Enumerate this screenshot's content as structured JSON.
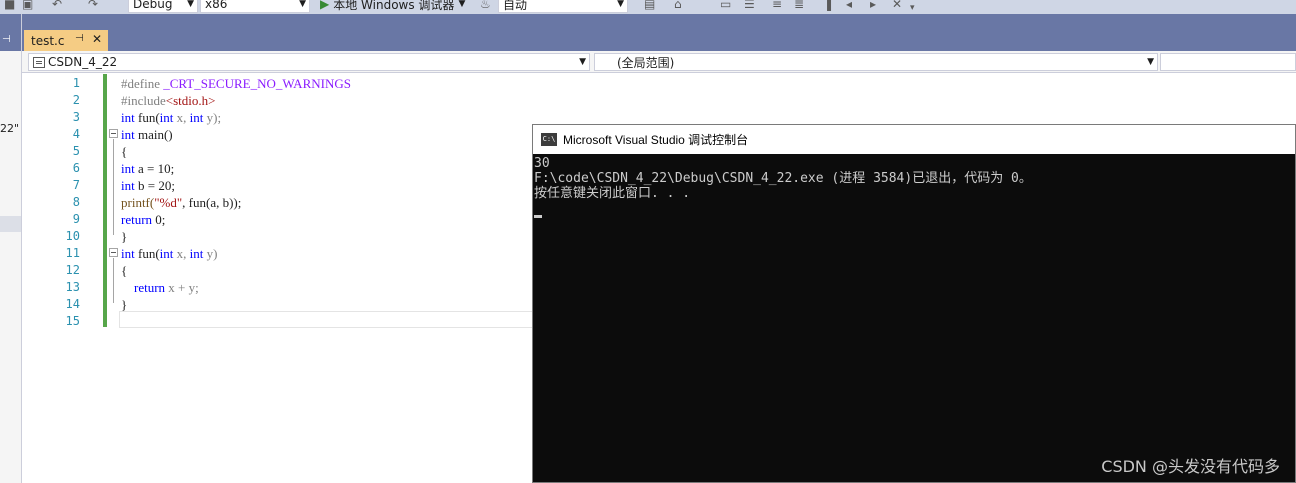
{
  "toolbar": {
    "config": "Debug",
    "platform": "x86",
    "run_label": "本地 Windows 调试器",
    "run_mode": "自动"
  },
  "left_panel": {
    "truncated_text": "22\""
  },
  "tabs": [
    {
      "label": "test.c",
      "active": true
    }
  ],
  "nav": {
    "project": "CSDN_4_22",
    "scope": "(全局范围)"
  },
  "editor": {
    "line_numbers": [
      "1",
      "2",
      "3",
      "4",
      "5",
      "6",
      "7",
      "8",
      "9",
      "10",
      "11",
      "12",
      "13",
      "14",
      "15"
    ],
    "lines": {
      "l1": {
        "pp": "#define ",
        "mac": "_CRT_SECURE_NO_WARNINGS"
      },
      "l2": {
        "pp": "#include",
        "str": "<stdio.h>"
      },
      "l3": {
        "kw1": "int",
        "fn": " fun(",
        "kw2": "int",
        "p1": " x, ",
        "kw3": "int",
        "p2": " y);"
      },
      "l4": {
        "kw": "int",
        "rest": " main()"
      },
      "l5": {
        "text": "{"
      },
      "l6": {
        "kw": "int",
        "rest": " a = 10;"
      },
      "l7": {
        "kw": "int",
        "rest": " b = 20;"
      },
      "l8": {
        "fn": "printf(",
        "str": "\"%d\"",
        "rest": ", fun(a, b));"
      },
      "l9": {
        "kw": "return",
        "rest": " 0;"
      },
      "l10": {
        "text": "}"
      },
      "l11": {
        "kw1": "int",
        "fn": " fun(",
        "kw2": "int",
        "p1": " x, ",
        "kw3": "int",
        "p2": " y)"
      },
      "l12": {
        "text": "{"
      },
      "l13": {
        "indent": "    ",
        "kw": "return",
        "rest": " x + y;"
      },
      "l14": {
        "text": "}"
      },
      "l15": {
        "text": ""
      }
    }
  },
  "console": {
    "title": "Microsoft Visual Studio 调试控制台",
    "icon_text": "C:\\",
    "output": [
      "30",
      "F:\\code\\CSDN_4_22\\Debug\\CSDN_4_22.exe (进程 3584)已退出，代码为 0。",
      "按任意键关闭此窗口. . ."
    ]
  },
  "watermark": "CSDN @头发没有代码多"
}
